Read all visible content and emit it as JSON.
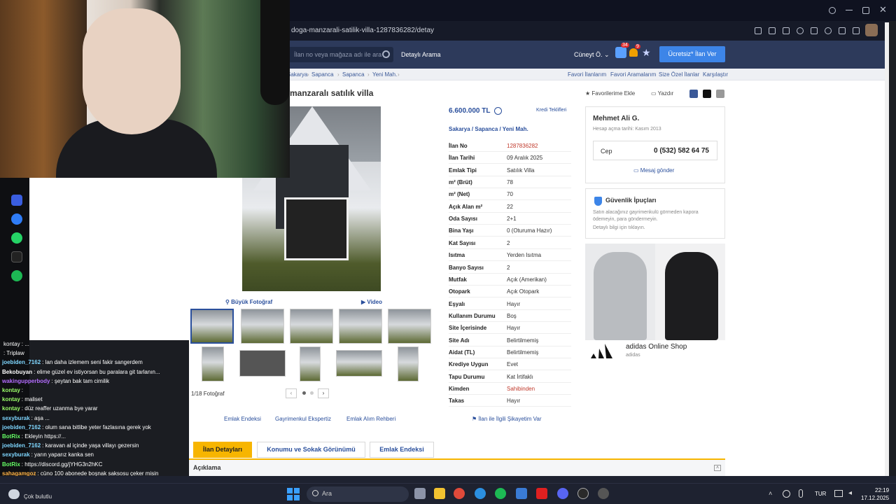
{
  "browser": {
    "url": "doga-manzarali-satilik-villa-1287836282/detay"
  },
  "site_header": {
    "search_placeholder": "İlan no veya mağaza adı ile ara",
    "detailed_search": "Detaylı Arama",
    "user": "Cüneyt Ö.",
    "messages_count": "34",
    "notifications_count": "9",
    "post_ad": "Ücretsiz* İlan Ver"
  },
  "breadcrumb": [
    "Sakarya",
    "Sapanca",
    "Sapanca",
    "Yeni Mah."
  ],
  "top_links": [
    "Favori İlanlarım",
    "Favori Aramalarım",
    "Size Özel İlanlar",
    "Karşılaştır"
  ],
  "listing": {
    "title": "manzaralı satılık villa",
    "add_favorite": "Favorilerime Ekle",
    "print": "Yazdır",
    "photo_large": "Büyük Fotoğraf",
    "video": "Video",
    "photo_count": "1/18 Fotoğraf",
    "price": "6.600.000 TL",
    "loan_offers": "Kredi Teklifleri",
    "location": "Sakarya  /  Sapanca  /  Yeni Mah.",
    "details": [
      {
        "key": "İlan No",
        "value": "1287836282"
      },
      {
        "key": "İlan Tarihi",
        "value": "09 Aralık 2025"
      },
      {
        "key": "Emlak Tipi",
        "value": "Satılık Villa"
      },
      {
        "key": "m² (Brüt)",
        "value": "78"
      },
      {
        "key": "m² (Net)",
        "value": "70"
      },
      {
        "key": "Açık Alan m²",
        "value": "22"
      },
      {
        "key": "Oda Sayısı",
        "value": "2+1"
      },
      {
        "key": "Bina Yaşı",
        "value": "0 (Oturuma Hazır)"
      },
      {
        "key": "Kat Sayısı",
        "value": "2"
      },
      {
        "key": "Isıtma",
        "value": "Yerden Isıtma"
      },
      {
        "key": "Banyo Sayısı",
        "value": "2"
      },
      {
        "key": "Mutfak",
        "value": "Açık (Amerikan)"
      },
      {
        "key": "Otopark",
        "value": "Açık Otopark"
      },
      {
        "key": "Eşyalı",
        "value": "Hayır"
      },
      {
        "key": "Kullanım Durumu",
        "value": "Boş"
      },
      {
        "key": "Site İçerisinde",
        "value": "Hayır"
      },
      {
        "key": "Site Adı",
        "value": "Belirtilmemiş"
      },
      {
        "key": "Aidat (TL)",
        "value": "Belirtilmemiş"
      },
      {
        "key": "Krediye Uygun",
        "value": "Evet"
      },
      {
        "key": "Tapu Durumu",
        "value": "Kat İrtifaklı"
      },
      {
        "key": "Kimden",
        "value": "Sahibinden"
      },
      {
        "key": "Takas",
        "value": "Hayır"
      }
    ]
  },
  "seller": {
    "name": "Mehmet Ali G.",
    "since": "Hesap açma tarihi: Kasım 2013",
    "phone_label": "Cep",
    "phone": "0 (532) 582 64 75",
    "message": "Mesaj gönder"
  },
  "safety": {
    "title": "Güvenlik İpuçları",
    "text": "Satın alacağınız gayrimenkulü görmeden kapora ödemeyin, para göndermeyin.",
    "link": "Detaylı bilgi için tıklayın."
  },
  "ad": {
    "title": "adidas Online Shop",
    "subtitle": "adidas"
  },
  "bottom_links": [
    "Emlak Endeksi",
    "Gayrimenkul Ekspertiz",
    "Emlak Alım Rehberi",
    "İlan ile İlgili Şikayetim Var"
  ],
  "tabs": [
    "İlan Detayları",
    "Konumu ve Sokak Görünümü",
    "Emlak Endeksi"
  ],
  "description_header": "Açıklama",
  "chat": [
    {
      "user": "",
      "text": "kontay : ..."
    },
    {
      "user": "",
      "text": ": Triplaw"
    },
    {
      "user": "joebiden_7162",
      "text": ": lan daha izlemem seni fakir sangerdem"
    },
    {
      "user": "Bekobuyan",
      "text": ": elime güzel ev istiyorsan bu paralara git tarlanın..."
    },
    {
      "user": "wakingupperbody",
      "text": ": şeytan bak tam cimilik"
    },
    {
      "user": "kontay",
      "text": ":"
    },
    {
      "user": "kontay",
      "text": ": maliset"
    },
    {
      "user": "kontay",
      "text": ": düz reaffer uzanma bye yarar"
    },
    {
      "user": "sexyburak",
      "text": ": aşa ..."
    },
    {
      "user": "joebiden_7162",
      "text": ": olum sana bitlibe yeter fazlasına gerek yok"
    },
    {
      "user": "BotRix",
      "text": ": Ekleyin https://..."
    },
    {
      "user": "joebiden_7162",
      "text": ": karavan al içinde yaşa villayı gezersin"
    },
    {
      "user": "sexyburak",
      "text": ": yarın yaparız kanka sen"
    },
    {
      "user": "BotRix",
      "text": ": https://discord.gg/jYHG3n2hKC"
    },
    {
      "user": "sahagamgoz",
      "text": ": cüno 100 abonede boşnak saksosu çeker misin"
    }
  ],
  "taskbar": {
    "weather": "Çok bulutlu",
    "search": "Ara",
    "lang": "TUR",
    "time": "22:19",
    "date": "17.12.2025"
  },
  "colors": {
    "accent_blue": "#2a4f9c",
    "header_bg": "#2d3a5b",
    "active_tab": "#f7b500",
    "link_red": "#c0392b"
  }
}
